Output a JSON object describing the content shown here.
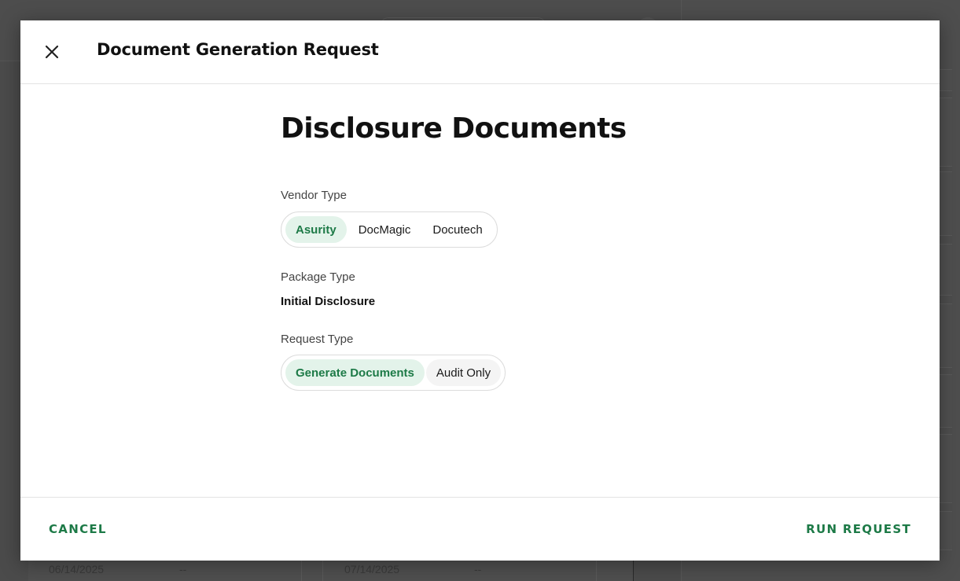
{
  "modal": {
    "title": "Document Generation Request",
    "close_icon": "close-icon",
    "section_title": "Disclosure Documents",
    "vendor_type": {
      "label": "Vendor Type",
      "options": [
        "Asurity",
        "DocMagic",
        "Docutech"
      ],
      "selected": "Asurity"
    },
    "package_type": {
      "label": "Package Type",
      "value": "Initial Disclosure"
    },
    "request_type": {
      "label": "Request Type",
      "options": [
        "Generate Documents",
        "Audit Only"
      ],
      "selected": "Generate Documents"
    },
    "footer": {
      "cancel_label": "CANCEL",
      "run_label": "RUN REQUEST"
    }
  },
  "background": {
    "table_row": [
      "06/14/2025",
      "--",
      "07/14/2025",
      "--"
    ]
  },
  "colors": {
    "accent": "#1d7a47",
    "selected_bg": "#e3f3ea",
    "overlay": "#4b4b4b"
  }
}
